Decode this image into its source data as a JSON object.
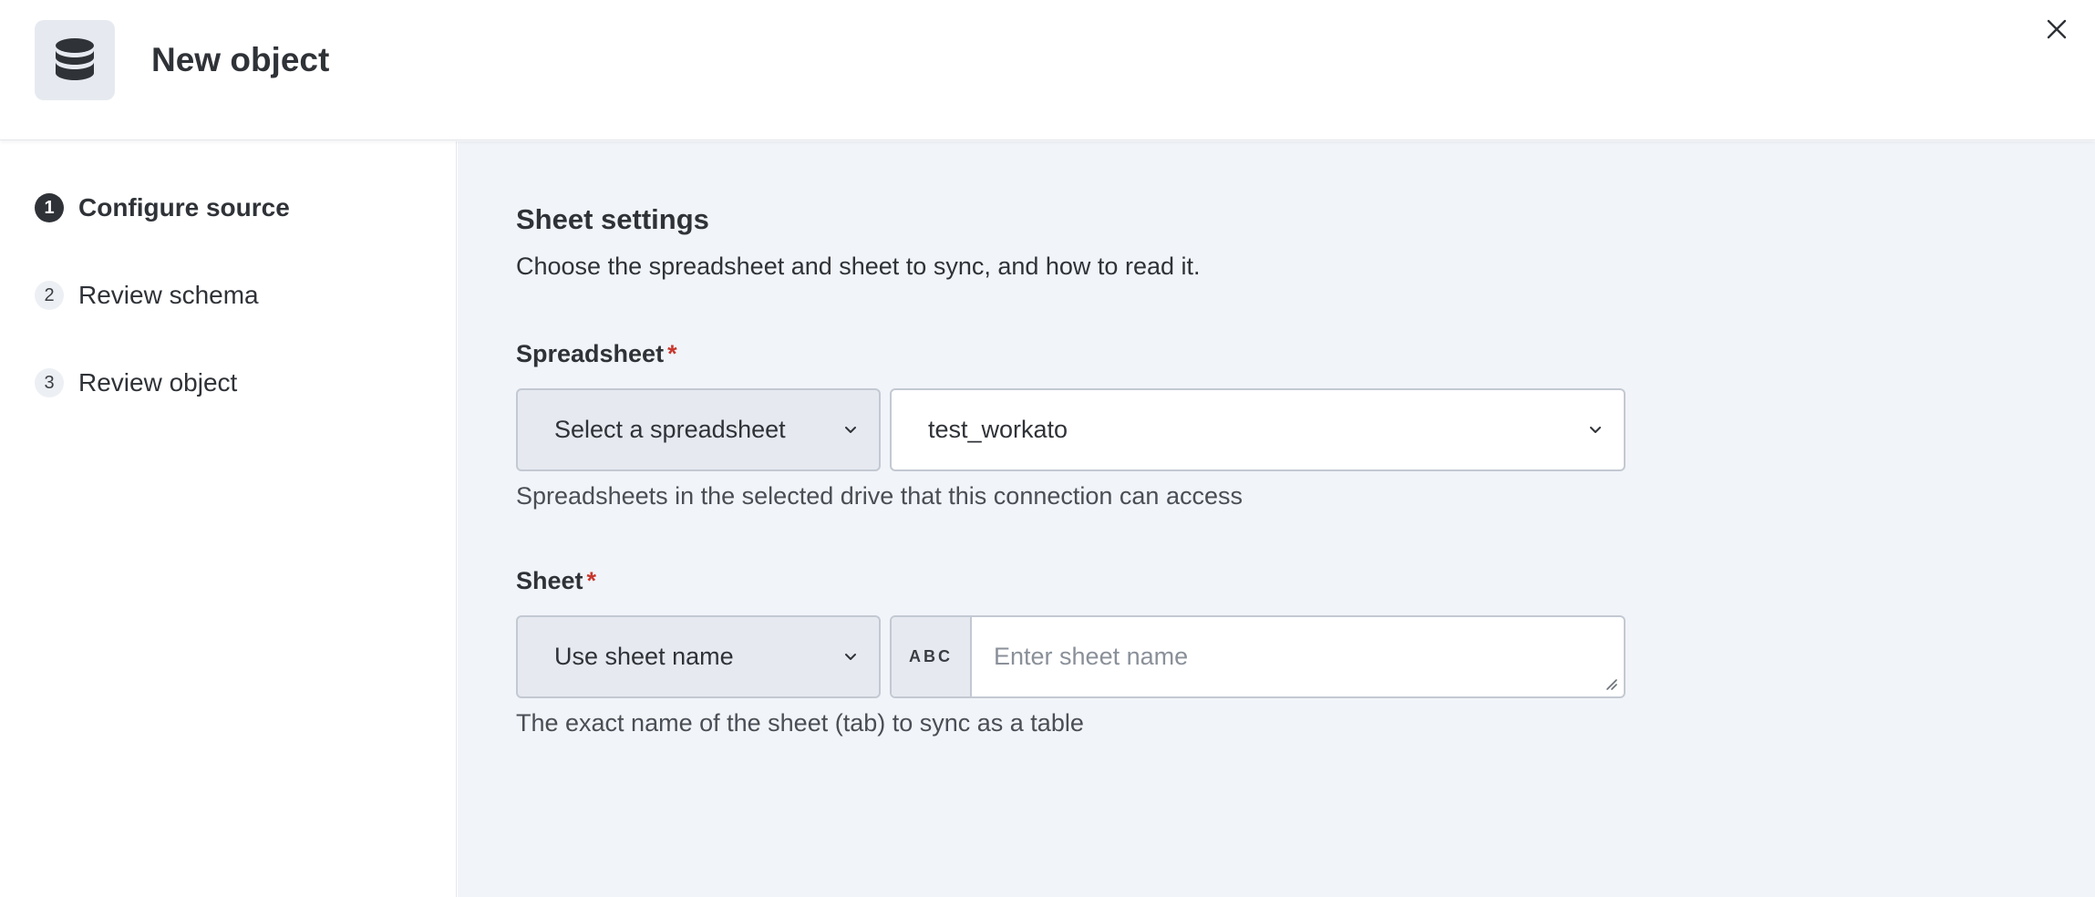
{
  "header": {
    "title": "New object",
    "icon": "database-icon",
    "close_icon": "close-icon"
  },
  "steps": [
    {
      "number": "1",
      "label": "Configure source",
      "active": true
    },
    {
      "number": "2",
      "label": "Review schema",
      "active": false
    },
    {
      "number": "3",
      "label": "Review object",
      "active": false
    }
  ],
  "main": {
    "title": "Sheet settings",
    "description": "Choose the spreadsheet and sheet to sync, and how to read it.",
    "spreadsheet": {
      "label": "Spreadsheet",
      "required_mark": "*",
      "mode_value": "Select a spreadsheet",
      "value": "test_workato",
      "helper": "Spreadsheets in the selected drive that this connection can access"
    },
    "sheet": {
      "label": "Sheet",
      "required_mark": "*",
      "mode_value": "Use sheet name",
      "badge": "ABC",
      "value": "",
      "placeholder": "Enter sheet name",
      "helper": "The exact name of the sheet (tab) to sync as a table"
    }
  },
  "colors": {
    "accent_dark": "#2f3237",
    "required": "#c8372d",
    "panel_bg": "#f1f4f9",
    "control_bg": "#e6eaf0",
    "border": "#c3c9d2"
  }
}
